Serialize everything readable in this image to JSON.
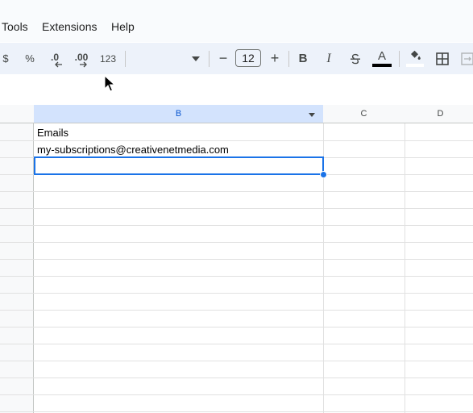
{
  "menu": {
    "items": [
      "Tools",
      "Extensions",
      "Help"
    ]
  },
  "toolbar": {
    "currency": "$",
    "percent": "%",
    "decrease_decimal": ".0",
    "increase_decimal": ".00",
    "number_format": "123",
    "font_size": "12",
    "decrease_font": "−",
    "increase_font": "+",
    "bold": "B",
    "italic": "I",
    "text_color": "A",
    "text_color_value": "#000000"
  },
  "sheet": {
    "columns": [
      "B",
      "C",
      "D"
    ],
    "selected_column": "B",
    "cells": {
      "B1": "Emails",
      "B2": "my-subscriptions@creativenetmedia.com",
      "B3": ""
    },
    "selected_cell": "B3",
    "accent_color": "#1a73e8"
  }
}
